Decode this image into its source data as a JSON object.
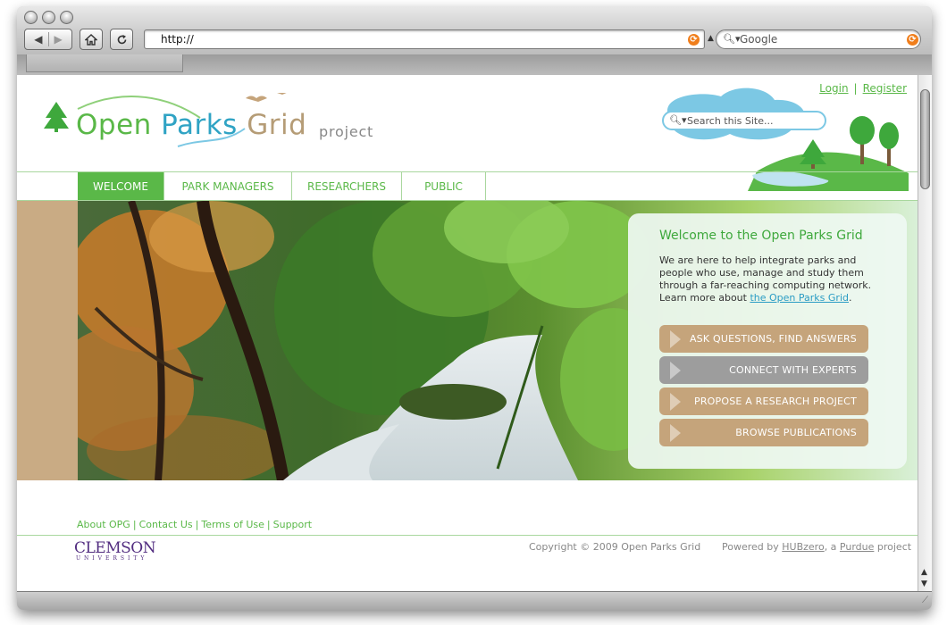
{
  "browser": {
    "url": "http://",
    "search_placeholder": "Google",
    "back_label": "◀ ▶",
    "home_icon": "home-icon",
    "reload_icon": "reload-icon"
  },
  "site": {
    "logo": {
      "open": "Open",
      "parks": "Parks",
      "grid": "Grid",
      "project": "project"
    },
    "toplinks": {
      "login": "Login",
      "sep": "|",
      "register": "Register"
    },
    "search_placeholder": "Search this Site...",
    "nav": [
      {
        "label": "WELCOME",
        "active": true
      },
      {
        "label": "PARK MANAGERS",
        "active": false
      },
      {
        "label": "RESEARCHERS",
        "active": false
      },
      {
        "label": "PUBLIC",
        "active": false
      }
    ],
    "welcome": {
      "title": "Welcome to the Open Parks Grid",
      "text": "We are here to help integrate parks and people who use, manage and study them through a far-reaching computing network. Learn more about ",
      "link": "the Open Parks Grid",
      "after_link": "."
    },
    "actions": [
      {
        "label": "ASK QUESTIONS, FIND ANSWERS",
        "color": "#c5a47b"
      },
      {
        "label": "CONNECT WITH EXPERTS",
        "color": "#9d9d9d"
      },
      {
        "label": "PROPOSE A RESEARCH PROJECT",
        "color": "#c5a47b"
      },
      {
        "label": "BROWSE PUBLICATIONS",
        "color": "#c5a47b"
      }
    ],
    "footer": {
      "links": [
        "About OPG",
        "Contact Us",
        "Terms of Use",
        "Support"
      ],
      "separator": "|",
      "clemson_word": "CLEMSON",
      "clemson_sub": "UNIVERSITY",
      "copyright": "Copyright © 2009 Open Parks Grid",
      "powered_prefix": "Powered by ",
      "powered_hub": "HUBzero",
      "powered_mid": ", a ",
      "powered_purdue": "Purdue",
      "powered_suffix": " project"
    }
  },
  "colors": {
    "green": "#5ab848",
    "blue": "#2fa3c4",
    "tan": "#c5a47b",
    "gray_button": "#9d9d9d"
  }
}
